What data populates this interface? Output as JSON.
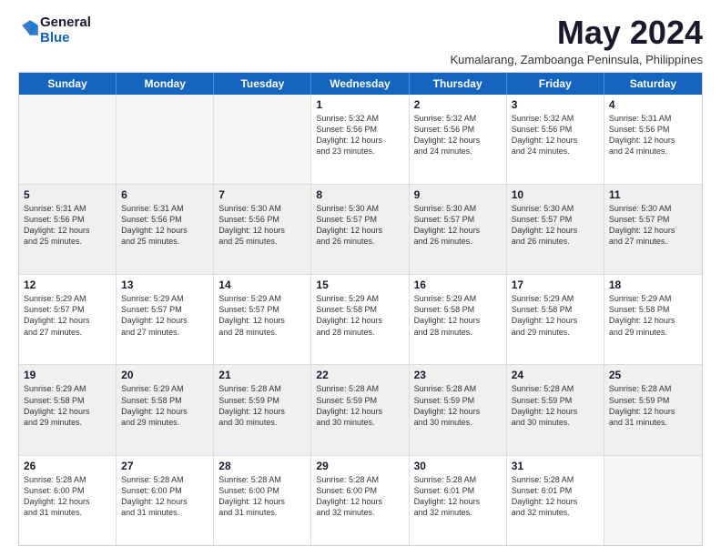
{
  "logo": {
    "line1": "General",
    "line2": "Blue"
  },
  "title": "May 2024",
  "subtitle": "Kumalarang, Zamboanga Peninsula, Philippines",
  "header_days": [
    "Sunday",
    "Monday",
    "Tuesday",
    "Wednesday",
    "Thursday",
    "Friday",
    "Saturday"
  ],
  "rows": [
    [
      {
        "day": "",
        "lines": [],
        "empty": true
      },
      {
        "day": "",
        "lines": [],
        "empty": true
      },
      {
        "day": "",
        "lines": [],
        "empty": true
      },
      {
        "day": "1",
        "lines": [
          "Sunrise: 5:32 AM",
          "Sunset: 5:56 PM",
          "Daylight: 12 hours",
          "and 23 minutes."
        ]
      },
      {
        "day": "2",
        "lines": [
          "Sunrise: 5:32 AM",
          "Sunset: 5:56 PM",
          "Daylight: 12 hours",
          "and 24 minutes."
        ]
      },
      {
        "day": "3",
        "lines": [
          "Sunrise: 5:32 AM",
          "Sunset: 5:56 PM",
          "Daylight: 12 hours",
          "and 24 minutes."
        ]
      },
      {
        "day": "4",
        "lines": [
          "Sunrise: 5:31 AM",
          "Sunset: 5:56 PM",
          "Daylight: 12 hours",
          "and 24 minutes."
        ]
      }
    ],
    [
      {
        "day": "5",
        "lines": [
          "Sunrise: 5:31 AM",
          "Sunset: 5:56 PM",
          "Daylight: 12 hours",
          "and 25 minutes."
        ],
        "shaded": true
      },
      {
        "day": "6",
        "lines": [
          "Sunrise: 5:31 AM",
          "Sunset: 5:56 PM",
          "Daylight: 12 hours",
          "and 25 minutes."
        ],
        "shaded": true
      },
      {
        "day": "7",
        "lines": [
          "Sunrise: 5:30 AM",
          "Sunset: 5:56 PM",
          "Daylight: 12 hours",
          "and 25 minutes."
        ],
        "shaded": true
      },
      {
        "day": "8",
        "lines": [
          "Sunrise: 5:30 AM",
          "Sunset: 5:57 PM",
          "Daylight: 12 hours",
          "and 26 minutes."
        ],
        "shaded": true
      },
      {
        "day": "9",
        "lines": [
          "Sunrise: 5:30 AM",
          "Sunset: 5:57 PM",
          "Daylight: 12 hours",
          "and 26 minutes."
        ],
        "shaded": true
      },
      {
        "day": "10",
        "lines": [
          "Sunrise: 5:30 AM",
          "Sunset: 5:57 PM",
          "Daylight: 12 hours",
          "and 26 minutes."
        ],
        "shaded": true
      },
      {
        "day": "11",
        "lines": [
          "Sunrise: 5:30 AM",
          "Sunset: 5:57 PM",
          "Daylight: 12 hours",
          "and 27 minutes."
        ],
        "shaded": true
      }
    ],
    [
      {
        "day": "12",
        "lines": [
          "Sunrise: 5:29 AM",
          "Sunset: 5:57 PM",
          "Daylight: 12 hours",
          "and 27 minutes."
        ]
      },
      {
        "day": "13",
        "lines": [
          "Sunrise: 5:29 AM",
          "Sunset: 5:57 PM",
          "Daylight: 12 hours",
          "and 27 minutes."
        ]
      },
      {
        "day": "14",
        "lines": [
          "Sunrise: 5:29 AM",
          "Sunset: 5:57 PM",
          "Daylight: 12 hours",
          "and 28 minutes."
        ]
      },
      {
        "day": "15",
        "lines": [
          "Sunrise: 5:29 AM",
          "Sunset: 5:58 PM",
          "Daylight: 12 hours",
          "and 28 minutes."
        ]
      },
      {
        "day": "16",
        "lines": [
          "Sunrise: 5:29 AM",
          "Sunset: 5:58 PM",
          "Daylight: 12 hours",
          "and 28 minutes."
        ]
      },
      {
        "day": "17",
        "lines": [
          "Sunrise: 5:29 AM",
          "Sunset: 5:58 PM",
          "Daylight: 12 hours",
          "and 29 minutes."
        ]
      },
      {
        "day": "18",
        "lines": [
          "Sunrise: 5:29 AM",
          "Sunset: 5:58 PM",
          "Daylight: 12 hours",
          "and 29 minutes."
        ]
      }
    ],
    [
      {
        "day": "19",
        "lines": [
          "Sunrise: 5:29 AM",
          "Sunset: 5:58 PM",
          "Daylight: 12 hours",
          "and 29 minutes."
        ],
        "shaded": true
      },
      {
        "day": "20",
        "lines": [
          "Sunrise: 5:29 AM",
          "Sunset: 5:58 PM",
          "Daylight: 12 hours",
          "and 29 minutes."
        ],
        "shaded": true
      },
      {
        "day": "21",
        "lines": [
          "Sunrise: 5:28 AM",
          "Sunset: 5:59 PM",
          "Daylight: 12 hours",
          "and 30 minutes."
        ],
        "shaded": true
      },
      {
        "day": "22",
        "lines": [
          "Sunrise: 5:28 AM",
          "Sunset: 5:59 PM",
          "Daylight: 12 hours",
          "and 30 minutes."
        ],
        "shaded": true
      },
      {
        "day": "23",
        "lines": [
          "Sunrise: 5:28 AM",
          "Sunset: 5:59 PM",
          "Daylight: 12 hours",
          "and 30 minutes."
        ],
        "shaded": true
      },
      {
        "day": "24",
        "lines": [
          "Sunrise: 5:28 AM",
          "Sunset: 5:59 PM",
          "Daylight: 12 hours",
          "and 30 minutes."
        ],
        "shaded": true
      },
      {
        "day": "25",
        "lines": [
          "Sunrise: 5:28 AM",
          "Sunset: 5:59 PM",
          "Daylight: 12 hours",
          "and 31 minutes."
        ],
        "shaded": true
      }
    ],
    [
      {
        "day": "26",
        "lines": [
          "Sunrise: 5:28 AM",
          "Sunset: 6:00 PM",
          "Daylight: 12 hours",
          "and 31 minutes."
        ]
      },
      {
        "day": "27",
        "lines": [
          "Sunrise: 5:28 AM",
          "Sunset: 6:00 PM",
          "Daylight: 12 hours",
          "and 31 minutes."
        ]
      },
      {
        "day": "28",
        "lines": [
          "Sunrise: 5:28 AM",
          "Sunset: 6:00 PM",
          "Daylight: 12 hours",
          "and 31 minutes."
        ]
      },
      {
        "day": "29",
        "lines": [
          "Sunrise: 5:28 AM",
          "Sunset: 6:00 PM",
          "Daylight: 12 hours",
          "and 32 minutes."
        ]
      },
      {
        "day": "30",
        "lines": [
          "Sunrise: 5:28 AM",
          "Sunset: 6:01 PM",
          "Daylight: 12 hours",
          "and 32 minutes."
        ]
      },
      {
        "day": "31",
        "lines": [
          "Sunrise: 5:28 AM",
          "Sunset: 6:01 PM",
          "Daylight: 12 hours",
          "and 32 minutes."
        ]
      },
      {
        "day": "",
        "lines": [],
        "empty": true
      }
    ]
  ]
}
